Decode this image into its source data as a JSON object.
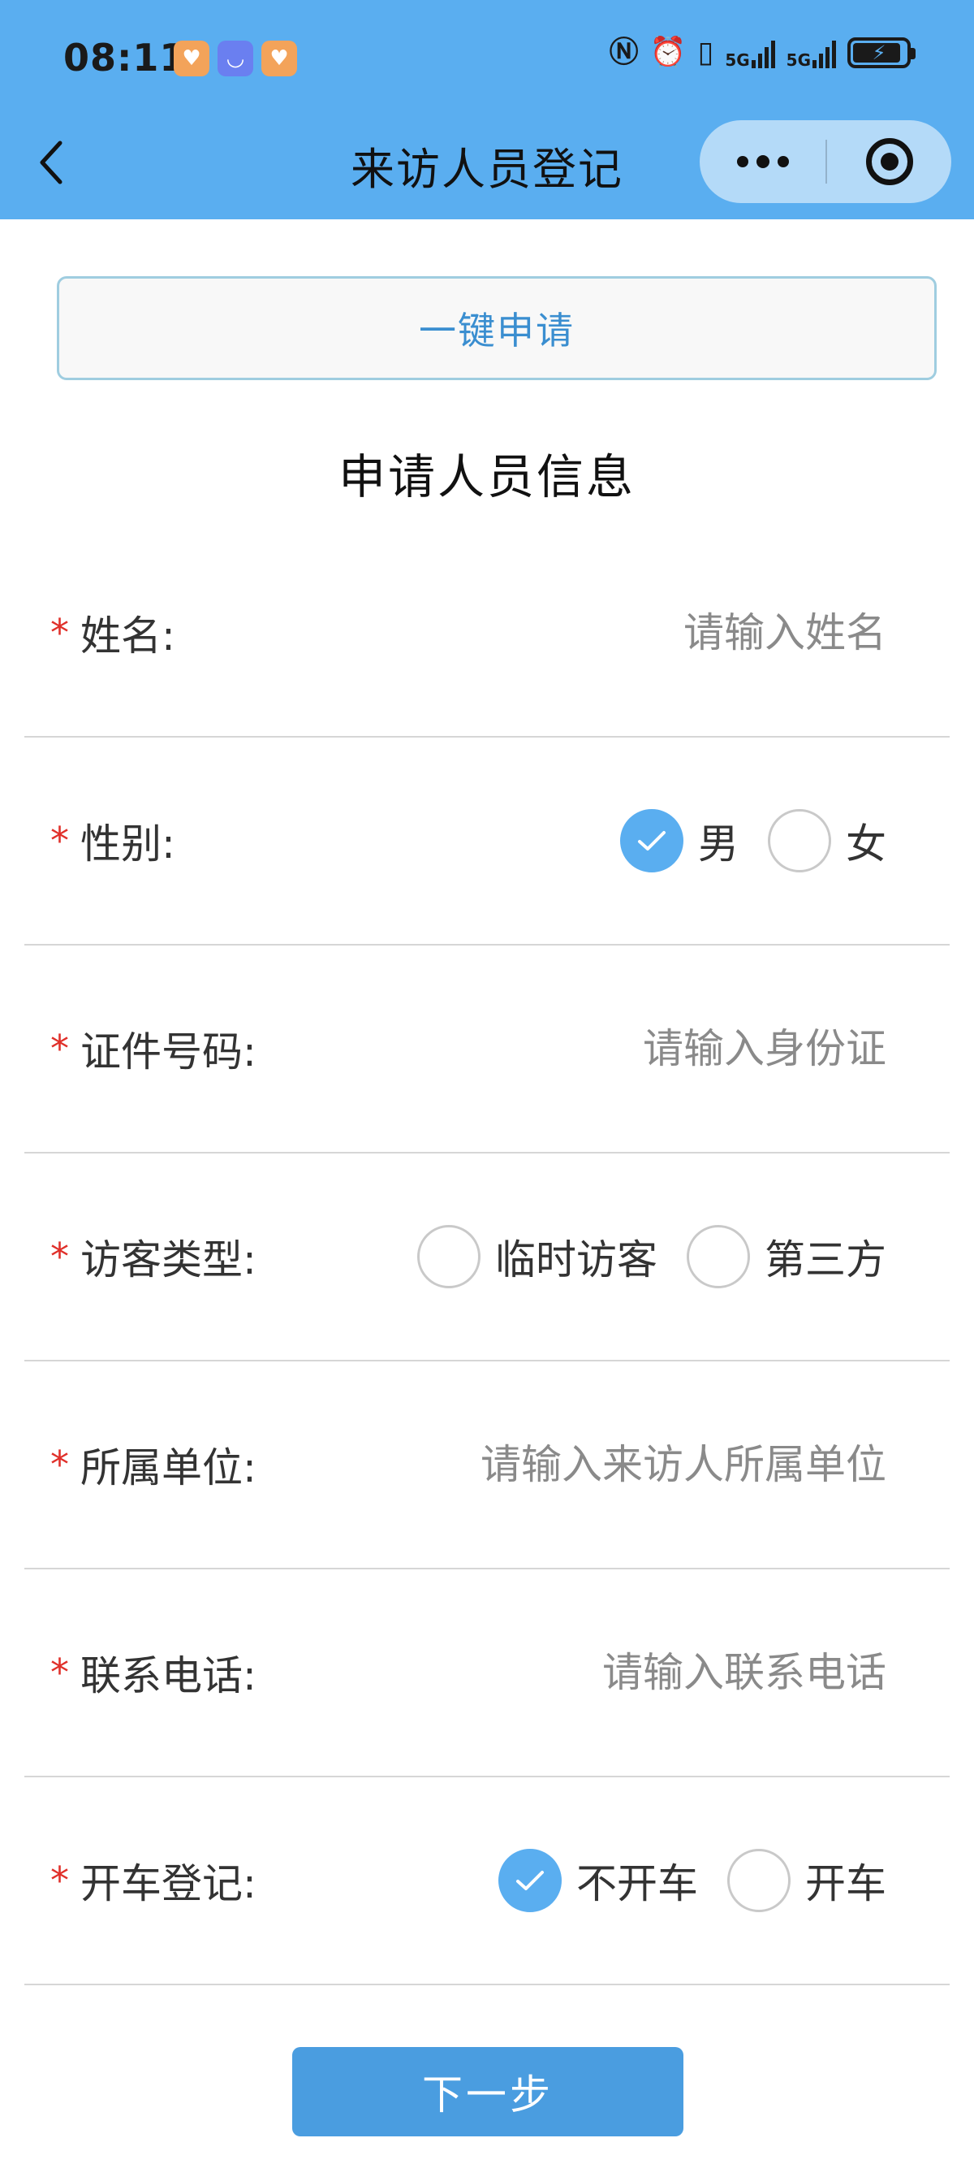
{
  "status_bar": {
    "time": "08:11",
    "signal_1_label": "5G",
    "signal_2_label": "5G",
    "app_icons": [
      "heart-app-icon",
      "honor-store-icon",
      "heart-app-icon"
    ],
    "status_icons": [
      "nfc-icon",
      "alarm-icon",
      "vibrate-icon",
      "signal-icon",
      "signal-icon",
      "battery-charging-icon"
    ]
  },
  "nav": {
    "title": "来访人员登记"
  },
  "one_click_label": "一键申请",
  "section_title": "申请人员信息",
  "form": {
    "required_mark": "*",
    "name": {
      "label": "姓名:",
      "placeholder": "请输入姓名"
    },
    "gender": {
      "label": "性别:",
      "options": [
        "男",
        "女"
      ],
      "selected": "男"
    },
    "id_number": {
      "label": "证件号码:",
      "placeholder": "请输入身份证"
    },
    "visitor_type": {
      "label": "访客类型:",
      "options": [
        "临时访客",
        "第三方"
      ],
      "selected": ""
    },
    "company": {
      "label": "所属单位:",
      "placeholder": "请输入来访人所属单位"
    },
    "phone": {
      "label": "联系电话:",
      "placeholder": "请输入联系电话"
    },
    "driving": {
      "label": "开车登记:",
      "options": [
        "不开车",
        "开车"
      ],
      "selected": "不开车"
    }
  },
  "next_button_label": "下一步",
  "colors": {
    "header_blue": "#5aaef0",
    "accent_blue": "#4a9de0",
    "required_red": "#e0302a",
    "link_blue": "#3a8ed0"
  }
}
